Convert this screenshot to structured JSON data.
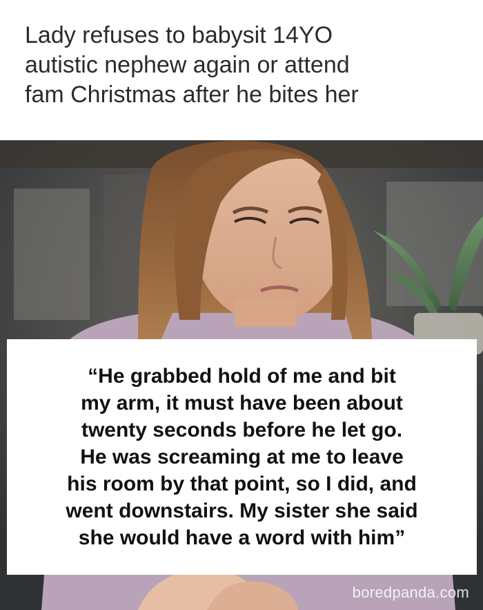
{
  "headline": {
    "lines": [
      "Lady refuses to babysit 14YO",
      "autistic nephew again or attend",
      "fam Christmas after he bites her"
    ]
  },
  "photo": {
    "subject": "woman-looking-down"
  },
  "quote": {
    "lines": [
      "“He grabbed hold of me and bit",
      "my arm, it must have been about",
      "twenty seconds before he let go.",
      "He was screaming at me to leave",
      "his room by that point, so I did, and",
      "went downstairs. My sister she said",
      "she would have a word with him”"
    ]
  },
  "watermark": {
    "text": "boredpanda.com"
  },
  "colors": {
    "headline_text": "#2b2b2b",
    "quote_text": "#111111",
    "quote_bg": "#ffffff"
  }
}
